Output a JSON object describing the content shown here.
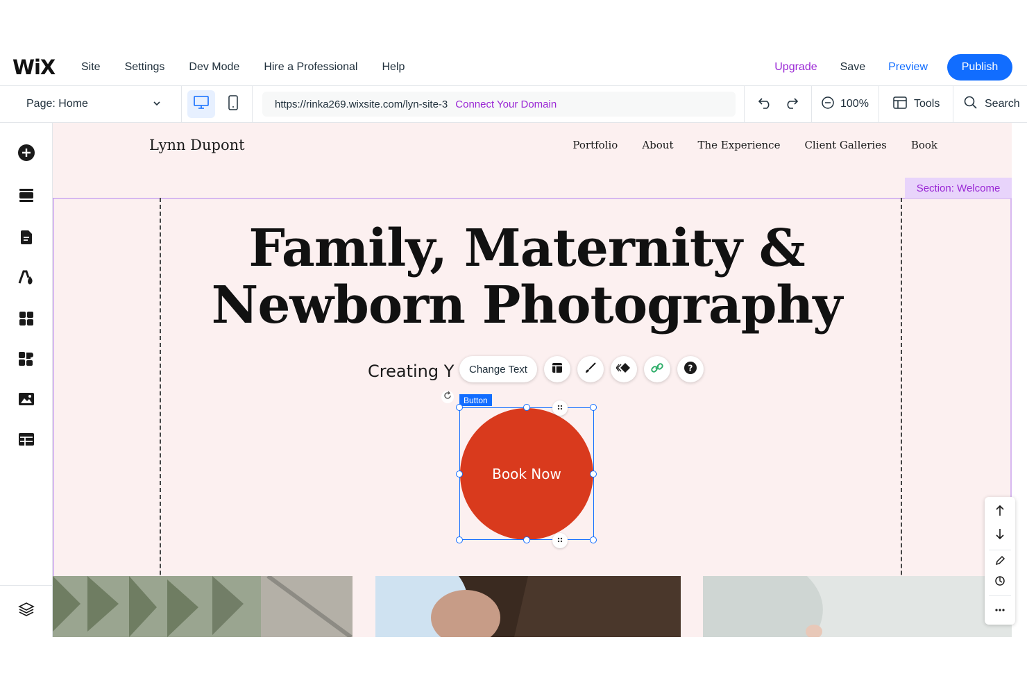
{
  "app": {
    "logo": "WiX",
    "menu": [
      "Site",
      "Settings",
      "Dev Mode",
      "Hire a Professional",
      "Help"
    ],
    "upgrade": "Upgrade",
    "save": "Save",
    "preview": "Preview",
    "publish": "Publish",
    "accent": "#116dff",
    "premium": "#9a27d5"
  },
  "toolbar": {
    "page_label": "Page: Home",
    "url": "https://rinka269.wixsite.com/lyn-site-3",
    "connect_domain": "Connect Your Domain",
    "zoom": "100%",
    "tools": "Tools",
    "search": "Search"
  },
  "sidebar": {
    "items": [
      "add-elements-icon",
      "add-section-icon",
      "pages-icon",
      "site-design-icon",
      "apps-icon",
      "business-apps-icon",
      "media-icon",
      "cms-icon"
    ],
    "bottom": "layers-icon"
  },
  "site": {
    "title": "Lynn Dupont",
    "nav": [
      "Portfolio",
      "About",
      "The Experience",
      "Client Galleries",
      "Book"
    ],
    "section_tag": "Section: Welcome",
    "hero_line1": "Family, Maternity &",
    "hero_line2": "Newborn Photography",
    "subtitle_visible": "Creating Y",
    "button_text": "Book Now",
    "button_color": "#d93a1d",
    "background": "#fcf0f0"
  },
  "selection": {
    "label": "Button",
    "change_text": "Change Text",
    "tools": [
      "layout-icon",
      "design-brush-icon",
      "animation-icon",
      "link-icon",
      "help-icon"
    ]
  },
  "right_panel": {
    "tools": [
      "move-up-icon",
      "move-down-icon",
      "edit-section-icon",
      "ai-icon",
      "more-icon"
    ]
  }
}
